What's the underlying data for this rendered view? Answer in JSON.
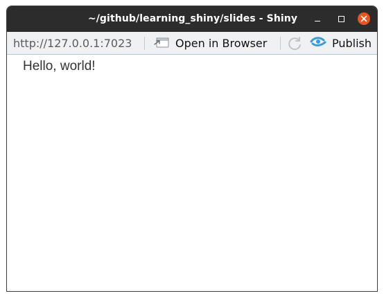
{
  "window": {
    "title": "~/github/learning_shiny/slides - Shiny"
  },
  "toolbar": {
    "url": "http://127.0.0.1:7023",
    "open_in_browser_label": "Open in Browser",
    "publish_label": "Publish"
  },
  "content": {
    "text": "Hello, world!"
  },
  "colors": {
    "titlebar_bg": "#2c2c2c",
    "close_button": "#e95420",
    "toolbar_bg": "#f0f1f3",
    "publish_icon": "#3b9bd6"
  },
  "icons": {
    "minimize": "minimize-icon",
    "maximize": "maximize-icon",
    "close": "close-icon",
    "open_in_browser": "open-in-browser-icon",
    "refresh": "refresh-icon",
    "publish": "publish-icon"
  }
}
